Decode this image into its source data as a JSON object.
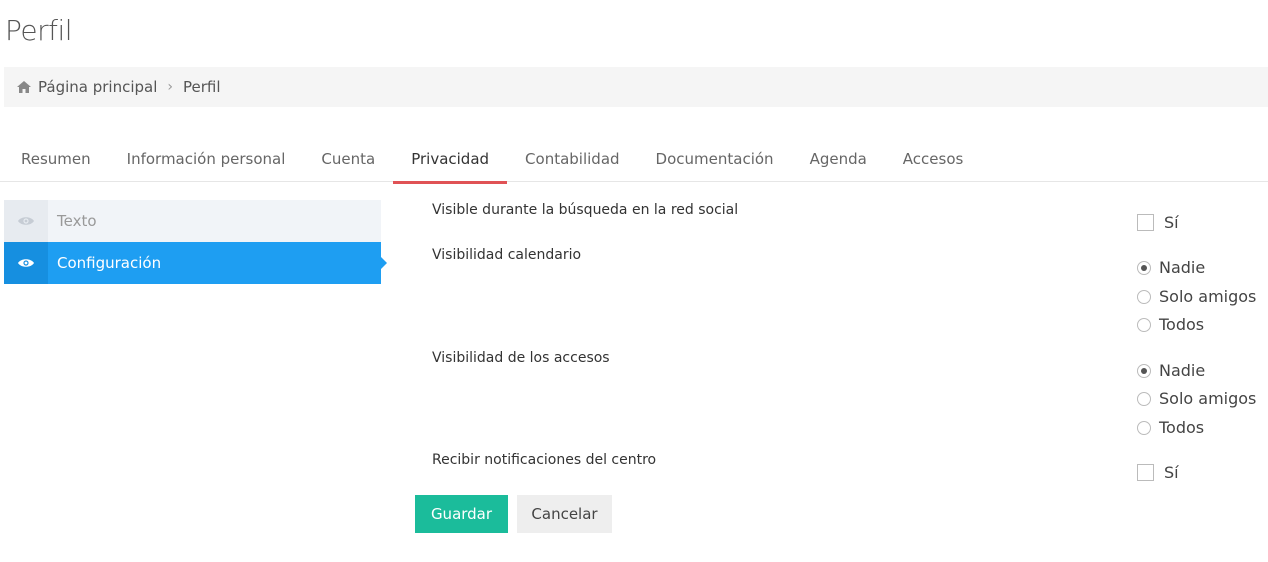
{
  "page": {
    "title": "Perfil"
  },
  "breadcrumb": {
    "home": "Página principal",
    "current": "Perfil"
  },
  "tabs": [
    {
      "label": "Resumen"
    },
    {
      "label": "Información personal"
    },
    {
      "label": "Cuenta"
    },
    {
      "label": "Privacidad",
      "active": true
    },
    {
      "label": "Contabilidad"
    },
    {
      "label": "Documentación"
    },
    {
      "label": "Agenda"
    },
    {
      "label": "Accesos"
    }
  ],
  "sidebar": {
    "items": [
      {
        "label": "Texto",
        "icon": "eye-icon",
        "active": false
      },
      {
        "label": "Configuración",
        "icon": "eye-icon",
        "active": true
      }
    ]
  },
  "form": {
    "search_visible": {
      "label": "Visible durante la búsqueda en la red social",
      "option": "Sí",
      "checked": false
    },
    "calendar_visibility": {
      "label": "Visibilidad calendario",
      "options": [
        "Nadie",
        "Solo amigos",
        "Todos"
      ],
      "selected": "Nadie"
    },
    "access_visibility": {
      "label": "Visibilidad de los accesos",
      "options": [
        "Nadie",
        "Solo amigos",
        "Todos"
      ],
      "selected": "Nadie"
    },
    "center_notifications": {
      "label": "Recibir notificaciones del centro",
      "option": "Sí",
      "checked": false
    }
  },
  "actions": {
    "save": "Guardar",
    "cancel": "Cancelar"
  },
  "colors": {
    "accent_blue": "#1e9ef2",
    "tab_underline": "#e05255",
    "save_green": "#1bbc9b"
  }
}
